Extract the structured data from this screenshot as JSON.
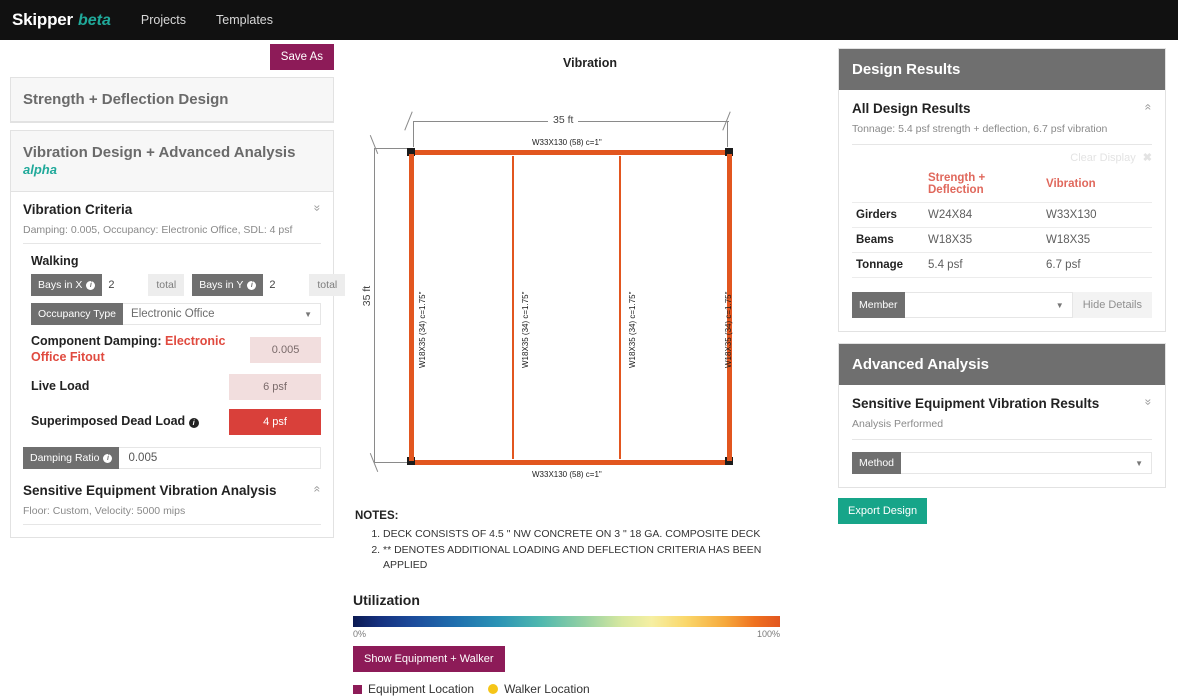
{
  "navbar": {
    "brand": "Skipper",
    "beta": "beta",
    "links": [
      {
        "label": "Projects"
      },
      {
        "label": "Templates"
      }
    ]
  },
  "left": {
    "save_as_label": "Save As",
    "strength_card_title": "Strength + Deflection Design",
    "vibration_card_title": "Vibration Design + Advanced Analysis",
    "vibration_card_tag": "alpha",
    "criteria": {
      "title": "Vibration Criteria",
      "chevron": "»",
      "summary": "Damping: 0.005, Occupancy: Electronic Office, SDL: 4 psf",
      "walking_heading": "Walking",
      "bays_x_label": "Bays in X",
      "bays_x_value": "2",
      "bays_x_unit": "total",
      "bays_y_label": "Bays in Y",
      "bays_y_value": "2",
      "bays_y_unit": "total",
      "occupancy_label": "Occupancy Type",
      "occupancy_value": "Electronic Office",
      "component_damping_label": "Component Damping:",
      "component_damping_highlight": "Electronic Office Fitout",
      "component_damping_value": "0.005",
      "live_load_label": "Live Load",
      "live_load_value": "6 psf",
      "sdl_label": "Superimposed Dead Load",
      "sdl_value": "4 psf",
      "damping_ratio_label": "Damping Ratio",
      "damping_ratio_value": "0.005"
    },
    "sensitive": {
      "title": "Sensitive Equipment Vibration Analysis",
      "chevron": "«",
      "summary": "Floor: Custom, Velocity: 5000 mips"
    }
  },
  "diagram": {
    "title": "Vibration",
    "top_dim": "35 ft",
    "left_dim": "35 ft",
    "girder_top_label": "W33X130 (58) c=1\"",
    "girder_bottom_label": "W33X130 (58) c=1\"",
    "beam_labels": [
      "W18X35 (34) c=1.75\"",
      "W18X35 (34) c=1.75\"",
      "W18X35 (34) c=1.75\"",
      "W18X35 (34) c=1.75\""
    ]
  },
  "notes": {
    "title": "NOTES:",
    "items": [
      "DECK CONSISTS OF 4.5 \" NW CONCRETE ON 3 \" 18 GA. COMPOSITE DECK",
      "** DENOTES ADDITIONAL LOADING AND DEFLECTION CRITERIA HAS BEEN APPLIED"
    ]
  },
  "utilization": {
    "title": "Utilization",
    "min_label": "0%",
    "max_label": "100%",
    "show_button": "Show Equipment + Walker",
    "legend": [
      {
        "label": "Equipment Location",
        "color": "#8d1b58",
        "shape": "square"
      },
      {
        "label": "Walker Location",
        "color": "#f5c518",
        "shape": "circle"
      }
    ]
  },
  "right": {
    "design_results": {
      "panel_title": "Design Results",
      "section_title": "All Design Results",
      "chevron": "«",
      "summary": "Tonnage: 5.4 psf strength + deflection, 6.7 psf vibration",
      "clear_display": "Clear Display",
      "clear_x": "✖",
      "columns": [
        "",
        "Strength + Deflection",
        "Vibration"
      ],
      "rows": [
        {
          "label": "Girders",
          "strength": "W24X84",
          "vibration": "W33X130"
        },
        {
          "label": "Beams",
          "strength": "W18X35",
          "vibration": "W18X35"
        },
        {
          "label": "Tonnage",
          "strength": "5.4 psf",
          "vibration": "6.7 psf"
        }
      ],
      "member_label": "Member",
      "member_value": "",
      "hide_details": "Hide Details"
    },
    "advanced_analysis": {
      "panel_title": "Advanced Analysis",
      "section_title": "Sensitive Equipment Vibration Results",
      "chevron": "»",
      "summary": "Analysis Performed",
      "method_label": "Method",
      "method_value": ""
    },
    "export_button": "Export Design"
  }
}
